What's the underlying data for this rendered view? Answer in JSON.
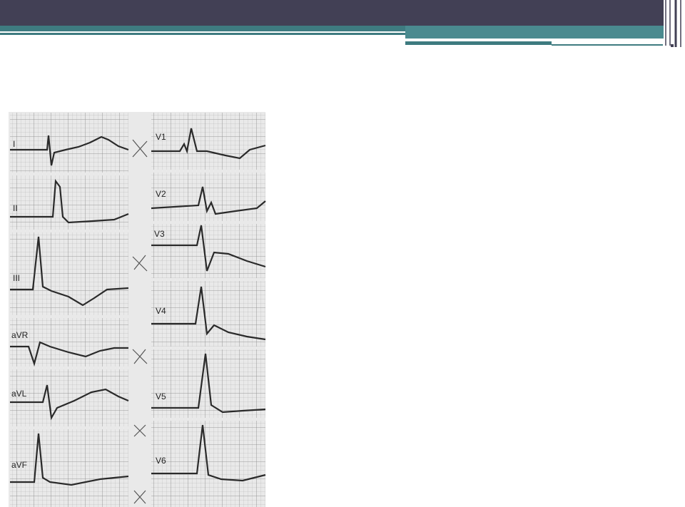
{
  "leads_left": [
    {
      "label": "I"
    },
    {
      "label": "II"
    },
    {
      "label": "III"
    },
    {
      "label": "aVR"
    },
    {
      "label": "aVL"
    },
    {
      "label": "aVF"
    }
  ],
  "leads_right": [
    {
      "label": "V1"
    },
    {
      "label": "V2"
    },
    {
      "label": "V3"
    },
    {
      "label": "V4"
    },
    {
      "label": "V5"
    },
    {
      "label": "V6"
    }
  ],
  "colors": {
    "header_dark": "#424055",
    "accent_teal": "#3e7b80",
    "grid_line": "#9a9a9a",
    "trace": "#2a2a2a"
  }
}
